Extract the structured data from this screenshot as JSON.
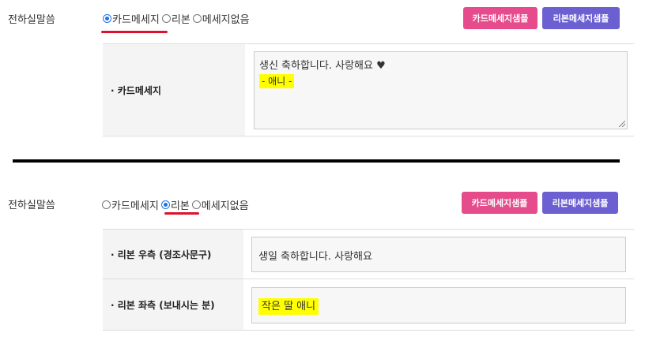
{
  "section1": {
    "label": "전하실말씀",
    "options": [
      "카드메세지",
      "리본",
      "메세지없음"
    ],
    "selected": "카드메세지",
    "buttons": {
      "card_sample": "카드메세지샘플",
      "ribbon_sample": "리본메세지샘플"
    },
    "card_field_label": "· 카드메세지",
    "card_message_line1": "생신 축하합니다.  사랑해요 ♥",
    "card_message_line2": "- 애니 -"
  },
  "section2": {
    "label": "전하실말씀",
    "options": [
      "카드메세지",
      "리본",
      "메세지없음"
    ],
    "selected": "리본",
    "buttons": {
      "card_sample": "카드메세지샘플",
      "ribbon_sample": "리본메세지샘플"
    },
    "ribbon_right_label": "· 리본 우측 (경조사문구)",
    "ribbon_right_value": "생일 축하합니다. 사랑해요",
    "ribbon_left_label": "· 리본 좌측 (보내시는 분)",
    "ribbon_left_value": "작은 딸 애니"
  },
  "colors": {
    "accent_radio": "#1a73e8",
    "underline": "#e0102a",
    "btn_pink": "#e64c8c",
    "btn_purple": "#6b5fd1",
    "highlight": "#ffff00"
  }
}
